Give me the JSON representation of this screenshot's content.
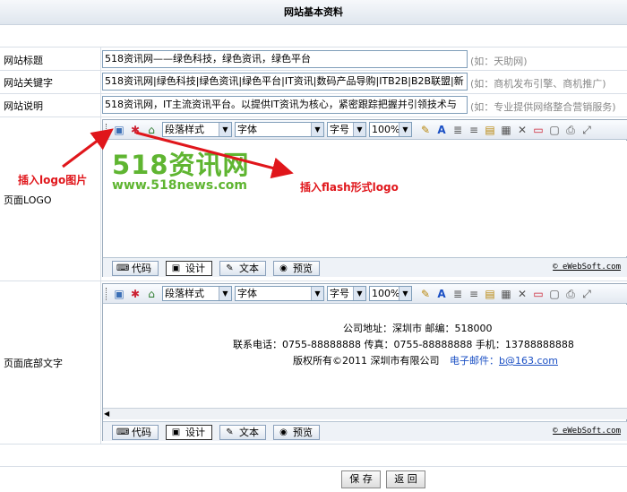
{
  "header": {
    "title": "网站基本资料"
  },
  "fields": {
    "title": {
      "label": "网站标题",
      "value": "518资讯网——绿色科技，绿色资讯，绿色平台",
      "hint": "(如：天助网)"
    },
    "keywords": {
      "label": "网站关键字",
      "value": "518资讯网|绿色科技|绿色资讯|绿色平台|IT资讯|数码产品导购|ITB2B|B2B联盟|新",
      "hint": "(如：商机发布引擎、商机推广)"
    },
    "description": {
      "label": "网站说明",
      "value": "518资讯网，IT主流资讯平台。以提供IT资讯为核心，紧密跟踪把握并引领技术与",
      "hint": "(如：专业提供网络整合营销服务)"
    },
    "logo": {
      "label": "页面LOGO"
    },
    "footer": {
      "label": "页面底部文字"
    }
  },
  "toolbar": {
    "paragraph_style": "段落样式",
    "font": "字体",
    "font_size": "字号",
    "zoom": "100%"
  },
  "logo_editor": {
    "logo_text": "518资讯网",
    "logo_url": "www.518news.com"
  },
  "annotations": {
    "insert_logo_image": "插入logo图片",
    "insert_flash_logo": "插入flash形式logo"
  },
  "footer_editor": {
    "line1": "公司地址：深圳市      邮编：518000",
    "line2": "联系电话：0755-88888888      传真：0755-88888888      手机：13788888888",
    "line3_prefix": "版权所有©2011 深圳市有限公司",
    "line3_email_label": "电子邮件：",
    "line3_email": "b@163.com"
  },
  "mode_tabs": {
    "code": "代码",
    "design": "设计",
    "text": "文本",
    "preview": "预览"
  },
  "brand": "eWebSoft.com",
  "buttons": {
    "save": "保 存",
    "back": "返 回"
  },
  "colors": {
    "accent": "#e0161b",
    "logo_green": "#5fb531",
    "link_blue": "#1a4fc4"
  }
}
